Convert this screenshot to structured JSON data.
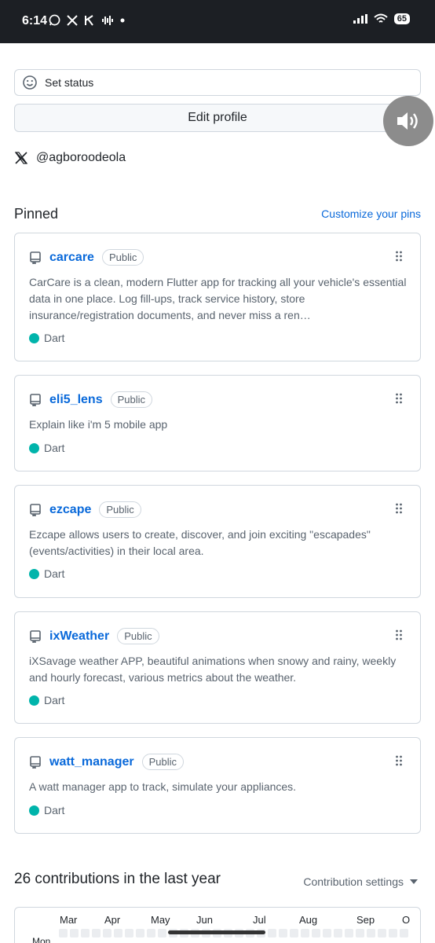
{
  "status_bar": {
    "time": "6:14",
    "battery": "65"
  },
  "profile": {
    "set_status_label": "Set status",
    "edit_profile_label": "Edit profile",
    "social_handle": "@agboroodeola"
  },
  "pinned": {
    "title": "Pinned",
    "customize_label": "Customize your pins",
    "repos": [
      {
        "name": "carcare",
        "visibility": "Public",
        "description": "CarCare is a clean, modern Flutter app for tracking all your vehicle's essential data in one place. Log fill-ups, track service history, store insurance/registration documents, and never miss a ren…",
        "language": "Dart"
      },
      {
        "name": "eli5_lens",
        "visibility": "Public",
        "description": "Explain like i'm 5 mobile app",
        "language": "Dart"
      },
      {
        "name": "ezcape",
        "visibility": "Public",
        "description": "Ezcape allows users to create, discover, and join exciting \"escapades\" (events/activities) in their local area.",
        "language": "Dart"
      },
      {
        "name": "ixWeather",
        "visibility": "Public",
        "description": "iXSavage weather APP, beautiful animations when snowy and rainy, weekly and hourly forecast, various metrics about the weather.",
        "language": "Dart"
      },
      {
        "name": "watt_manager",
        "visibility": "Public",
        "description": "A watt manager app to track, simulate your appliances.",
        "language": "Dart"
      }
    ],
    "language_color": "#00b4ab"
  },
  "contributions": {
    "title": "26 contributions in the last year",
    "settings_label": "Contribution settings",
    "months": [
      "Mar",
      "Apr",
      "May",
      "Jun",
      "Jul",
      "Aug",
      "Sep",
      "O"
    ],
    "day_label": "Mon"
  },
  "colors": {
    "link": "#0969da",
    "border": "#d0d7de",
    "statusbar": "#1c1f24"
  }
}
